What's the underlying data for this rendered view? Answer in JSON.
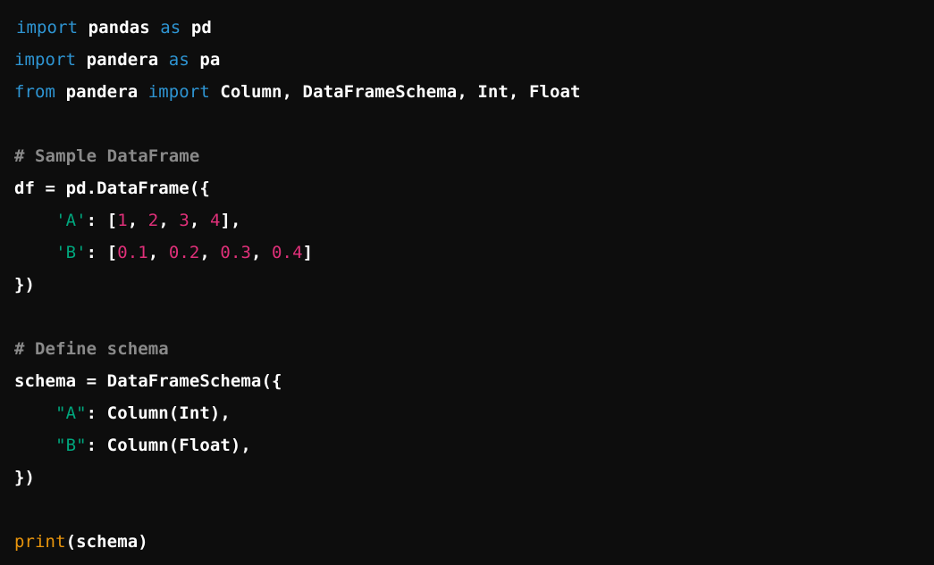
{
  "code": {
    "language": "python",
    "colors": {
      "background": "#0d0d0d",
      "keyword": "#2e95d3",
      "comment": "#8a8a8a",
      "string": "#00a67d",
      "number": "#df3079",
      "builtin": "#e9950c",
      "text": "#ffffff"
    },
    "lines": [
      {
        "tokens": [
          {
            "t": "import",
            "c": "kw"
          },
          {
            "t": " pandas "
          },
          {
            "t": "as",
            "c": "kw"
          },
          {
            "t": " pd"
          }
        ]
      },
      {
        "tokens": [
          {
            "t": "import",
            "c": "kw"
          },
          {
            "t": " pandera "
          },
          {
            "t": "as",
            "c": "kw"
          },
          {
            "t": " pa"
          }
        ]
      },
      {
        "tokens": [
          {
            "t": "from",
            "c": "kw"
          },
          {
            "t": " pandera "
          },
          {
            "t": "import",
            "c": "kw"
          },
          {
            "t": " Column, DataFrameSchema, Int, Float"
          }
        ]
      },
      {
        "tokens": []
      },
      {
        "tokens": [
          {
            "t": "# Sample DataFrame",
            "c": "cm"
          }
        ]
      },
      {
        "tokens": [
          {
            "t": "df = pd.DataFrame({"
          }
        ]
      },
      {
        "tokens": [
          {
            "t": "    "
          },
          {
            "t": "'A'",
            "c": "str"
          },
          {
            "t": ": ["
          },
          {
            "t": "1",
            "c": "num"
          },
          {
            "t": ", "
          },
          {
            "t": "2",
            "c": "num"
          },
          {
            "t": ", "
          },
          {
            "t": "3",
            "c": "num"
          },
          {
            "t": ", "
          },
          {
            "t": "4",
            "c": "num"
          },
          {
            "t": "],"
          }
        ]
      },
      {
        "tokens": [
          {
            "t": "    "
          },
          {
            "t": "'B'",
            "c": "str"
          },
          {
            "t": ": ["
          },
          {
            "t": "0.1",
            "c": "num"
          },
          {
            "t": ", "
          },
          {
            "t": "0.2",
            "c": "num"
          },
          {
            "t": ", "
          },
          {
            "t": "0.3",
            "c": "num"
          },
          {
            "t": ", "
          },
          {
            "t": "0.4",
            "c": "num"
          },
          {
            "t": "]"
          }
        ]
      },
      {
        "tokens": [
          {
            "t": "})"
          }
        ]
      },
      {
        "tokens": []
      },
      {
        "tokens": [
          {
            "t": "# Define schema",
            "c": "cm"
          }
        ]
      },
      {
        "tokens": [
          {
            "t": "schema = DataFrameSchema({"
          }
        ]
      },
      {
        "tokens": [
          {
            "t": "    "
          },
          {
            "t": "\"A\"",
            "c": "str"
          },
          {
            "t": ": Column(Int),"
          }
        ]
      },
      {
        "tokens": [
          {
            "t": "    "
          },
          {
            "t": "\"B\"",
            "c": "str"
          },
          {
            "t": ": Column(Float),"
          }
        ]
      },
      {
        "tokens": [
          {
            "t": "})"
          }
        ]
      },
      {
        "tokens": []
      },
      {
        "tokens": [
          {
            "t": "print",
            "c": "fn"
          },
          {
            "t": "(schema)"
          }
        ]
      }
    ]
  }
}
